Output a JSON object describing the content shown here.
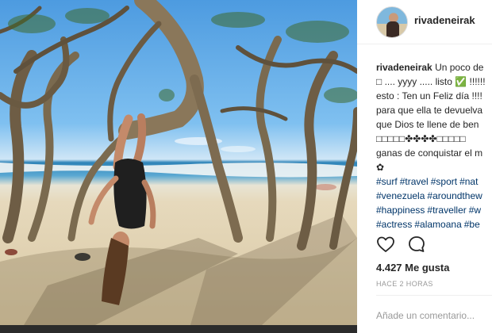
{
  "post": {
    "username": "rivadeneirak",
    "caption_lines": [
      {
        "user": "rivadeneirak",
        "text": "Un poco de"
      },
      {
        "text": "□ .... yyyy ..... listo ✅ !!!!!!"
      },
      {
        "text": "esto : Ten un Feliz día !!!!"
      },
      {
        "text": "para que ella te devuelva"
      },
      {
        "text": "que Dios te llene de ben"
      },
      {
        "text": "□□□□□✤✤✤✤□□□□□"
      },
      {
        "text": "ganas de conquistar el m"
      },
      {
        "text": "✿"
      }
    ],
    "hashtag_lines": [
      [
        "#surf",
        "#travel",
        "#sport",
        "#nat"
      ],
      [
        "#venezuela",
        "#aroundthew"
      ],
      [
        "#happiness",
        "#traveller",
        "#w"
      ],
      [
        "#actress",
        "#alamoana",
        "#be"
      ]
    ],
    "likes": "4.427 Me gusta",
    "time": "HACE 2 HORAS",
    "comment_placeholder": "Añade un comentario..."
  },
  "icons": {
    "like": "heart-outline-icon",
    "comment": "speech-bubble-icon"
  },
  "colors": {
    "text": "#262626",
    "hashtag": "#003569",
    "muted": "#999999",
    "divider": "#efefef"
  }
}
